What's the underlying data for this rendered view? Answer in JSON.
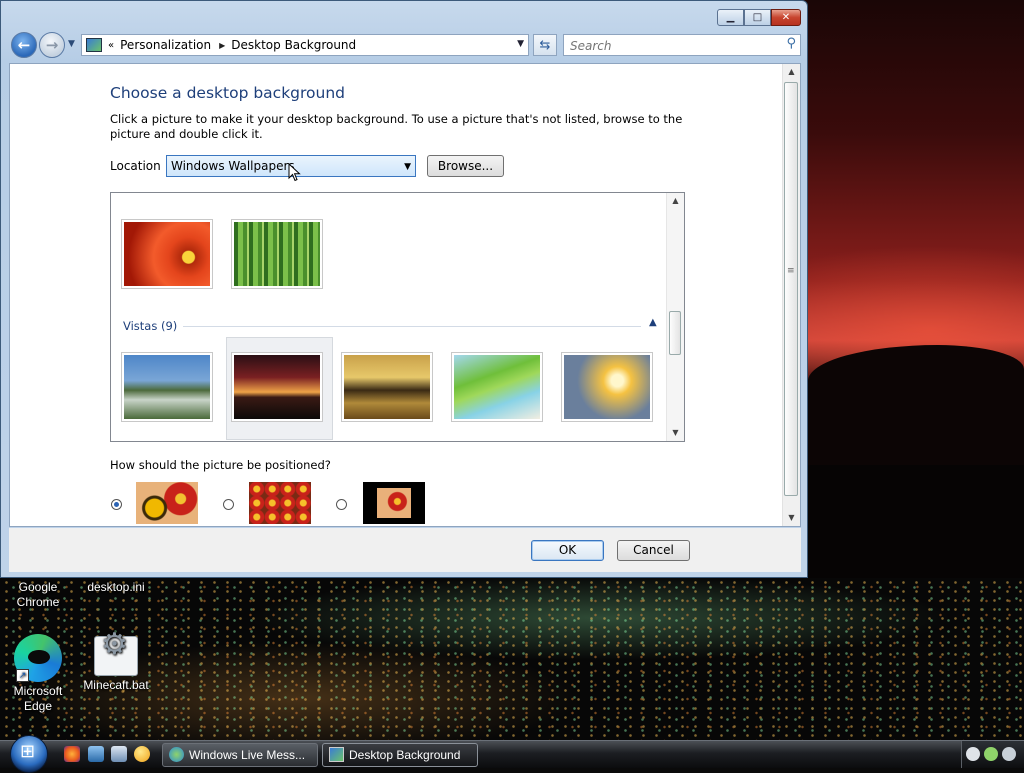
{
  "window": {
    "minimize": "▁",
    "maximize": "□",
    "close": "✕"
  },
  "nav": {
    "breadcrumb": [
      "Personalization",
      "Desktop Background"
    ],
    "crumb_prefix": "«",
    "search_placeholder": "Search"
  },
  "page": {
    "heading": "Choose a desktop background",
    "description": "Click a picture to make it your desktop background. To use a picture that's not listed, browse to the picture and double click it.",
    "location_label": "Location",
    "location_value": "Windows Wallpapers",
    "browse_label": "Browse...",
    "group_header": "Vistas (9)",
    "position_question": "How should the picture be positioned?",
    "position_selected": "fill",
    "ok_label": "OK",
    "cancel_label": "Cancel"
  },
  "thumbnails_top": [
    "flower",
    "bamboo"
  ],
  "thumbnails_vistas": [
    "vista1",
    "vista2",
    "vista3",
    "vista4",
    "vista5"
  ],
  "selected_thumbnail": "vista2",
  "desktop_icons": {
    "chrome": "Google Chrome",
    "desktop_ini": "desktop.ini",
    "edge": "Microsoft Edge",
    "minecraft": "Minecaft.bat"
  },
  "taskbar": {
    "tasks": [
      "Windows Live Mess...",
      "Desktop Background"
    ],
    "active_task": "Desktop Background"
  },
  "colors": {
    "heading": "#1e3f7a",
    "selection_border": "#3a76c0",
    "taskbar": "#1c1e22"
  }
}
